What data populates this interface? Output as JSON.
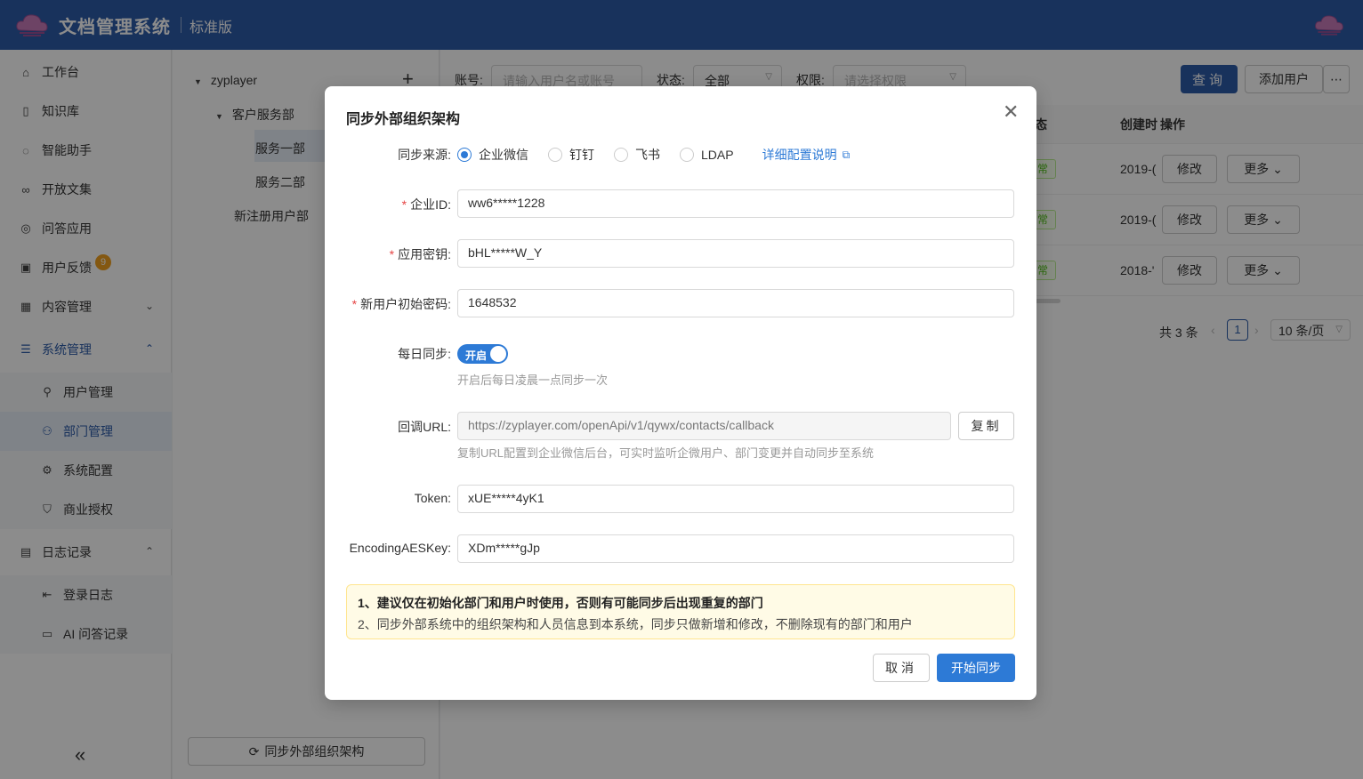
{
  "header": {
    "app_title": "文档管理系统",
    "edition": "标准版"
  },
  "sidebar": {
    "items": [
      {
        "label": "工作台",
        "icon": "home-icon"
      },
      {
        "label": "知识库",
        "icon": "book-icon"
      },
      {
        "label": "智能助手",
        "icon": "chat-icon"
      },
      {
        "label": "开放文集",
        "icon": "link-icon"
      },
      {
        "label": "问答应用",
        "icon": "qa-icon"
      },
      {
        "label": "用户反馈",
        "icon": "feedback-icon",
        "badge": "9"
      },
      {
        "label": "内容管理",
        "icon": "grid-icon"
      },
      {
        "label": "系统管理",
        "icon": "settings-sliders-icon"
      },
      {
        "label": "用户管理",
        "icon": "user-icon"
      },
      {
        "label": "部门管理",
        "icon": "team-icon"
      },
      {
        "label": "系统配置",
        "icon": "gear-icon"
      },
      {
        "label": "商业授权",
        "icon": "shield-icon"
      },
      {
        "label": "日志记录",
        "icon": "log-icon"
      },
      {
        "label": "登录日志",
        "icon": "login-icon"
      },
      {
        "label": "AI 问答记录",
        "icon": "ai-chat-icon"
      }
    ]
  },
  "tree": {
    "root": "zyplayer",
    "nodes": [
      "客户服务部",
      "服务一部",
      "服务二部",
      "新注册用户部"
    ],
    "sync_button": "同步外部组织架构"
  },
  "filters": {
    "account_label": "账号:",
    "account_placeholder": "请输入用户名或账号",
    "status_label": "状态:",
    "status_value": "全部",
    "permission_label": "权限:",
    "permission_placeholder": "请选择权限",
    "query_button": "查询",
    "add_user_button": "添加用户",
    "more_icon": "ellipsis-icon"
  },
  "table": {
    "headers": {
      "status": "态",
      "created": "创建时",
      "actions": "操作"
    },
    "rows": [
      {
        "status": "常",
        "created": "2019-(",
        "edit": "修改",
        "more": "更多"
      },
      {
        "status": "常",
        "created": "2019-(",
        "edit": "修改",
        "more": "更多"
      },
      {
        "status": "常",
        "created": "2018-'",
        "edit": "修改",
        "more": "更多"
      }
    ]
  },
  "pagination": {
    "total": "共 3 条",
    "current_page": "1",
    "page_size": "10 条/页"
  },
  "modal": {
    "title": "同步外部组织架构",
    "source_label": "同步来源:",
    "sources": [
      "企业微信",
      "钉钉",
      "飞书",
      "LDAP"
    ],
    "selected_source": "企业微信",
    "help_link": "详细配置说明",
    "corp_id_label": "企业ID:",
    "corp_id_value": "ww6*****1228",
    "secret_label": "应用密钥:",
    "secret_value": "bHL*****W_Y",
    "init_password_label": "新用户初始密码:",
    "init_password_value": "1648532",
    "daily_sync_label": "每日同步:",
    "daily_sync_switch": "开启",
    "daily_sync_hint": "开启后每日凌晨一点同步一次",
    "callback_label": "回调URL:",
    "callback_value": "https://zyplayer.com/openApi/v1/qywx/contacts/callback",
    "copy_button": "复制",
    "callback_hint": "复制URL配置到企业微信后台，可实时监听企微用户、部门变更并自动同步至系统",
    "token_label": "Token:",
    "token_value": "xUE*****4yK1",
    "aes_label": "EncodingAESKey:",
    "aes_value": "XDm*****gJp",
    "notice_line1": "1、建议仅在初始化部门和用户时使用，否则有可能同步后出现重复的部门",
    "notice_line2": "2、同步外部系统中的组织架构和人员信息到本系统，同步只做新增和修改，不删除现有的部门和用户",
    "cancel_button": "取消",
    "start_button": "开始同步"
  },
  "colors": {
    "header_bg": "#2d5ba8",
    "primary": "#2d7ad6",
    "required": "#e64545",
    "notice_bg": "#fffbe6"
  }
}
